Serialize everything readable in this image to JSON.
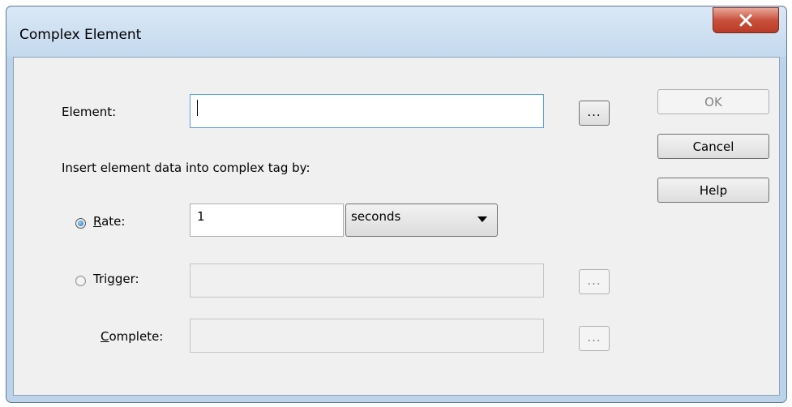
{
  "window": {
    "title": "Complex Element",
    "close_glyph": "X"
  },
  "element": {
    "label": "Element:",
    "value": "",
    "browse_label": "..."
  },
  "insert_label": "Insert element data into complex tag by:",
  "rate": {
    "label_first": "R",
    "label_rest": "ate:",
    "checked": true,
    "value": "1",
    "unit_selected": "seconds"
  },
  "trigger": {
    "label_first": "Tri",
    "label_u": "g",
    "label_rest": "ger:",
    "checked": false,
    "value": "",
    "browse_label": "..."
  },
  "complete": {
    "label_u": "C",
    "label_rest": "omplete:",
    "value": "",
    "browse_label": "..."
  },
  "buttons": {
    "ok": "OK",
    "cancel": "Cancel",
    "help": "Help"
  },
  "icons": {
    "close": "close-icon",
    "dropdown": "chevron-down-icon"
  }
}
